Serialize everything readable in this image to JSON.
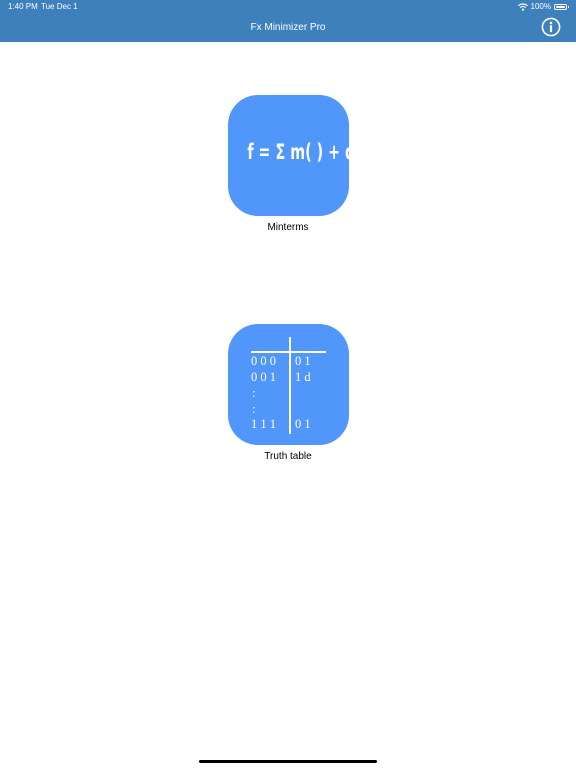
{
  "status_bar": {
    "time": "1:40 PM",
    "date": "Tue Dec 1",
    "battery": "100%",
    "battery_level": 1.0,
    "icons": [
      "wifi-icon",
      "battery-icon"
    ]
  },
  "nav": {
    "title": "Fx Minimizer Pro",
    "info_icon": "info-icon"
  },
  "colors": {
    "nav_bar": "#3e80bc",
    "tile": "#5196fb",
    "text_on_dark": "#ffffff",
    "label_text": "#000000"
  },
  "items": [
    {
      "label": "Minterms",
      "icon_text": "f = Σ m( ) + d( )"
    },
    {
      "label": "Truth table",
      "table": {
        "inputs": [
          "0 0 0",
          "0 0 1",
          ":",
          ":",
          "1 1 1"
        ],
        "outputs": [
          "0 1",
          "1 d",
          "",
          "",
          "0 1"
        ]
      }
    }
  ]
}
